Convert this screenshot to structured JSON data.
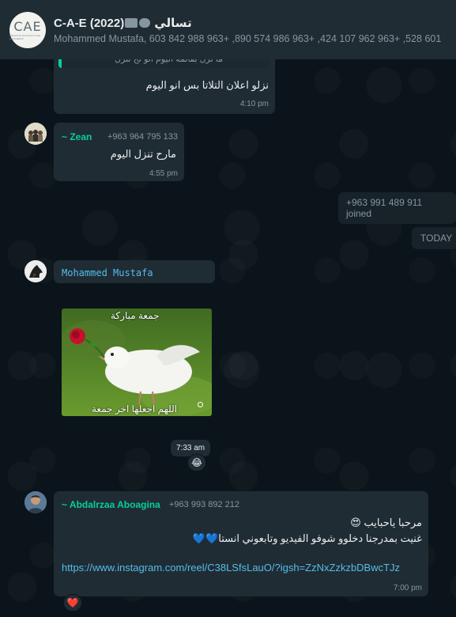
{
  "header": {
    "avatar_text": "CAE",
    "avatar_subtext": "CREATIVE ARCHITECTURE ENGINEERS",
    "title_prefix": "C-A-E (2022)",
    "title_suffix": "تسالي",
    "members": "Mohammed Mustafa, 603 842 988 963+ ,890 574 986 963+ ,424 107 962 963+ ,528 601"
  },
  "messages": {
    "m1": {
      "quote": "ما نزل بقائمة اليوم انو لح تنزل",
      "text": "نزلو اعلان التلاتا بس انو اليوم",
      "time": "4:10 pm"
    },
    "m2": {
      "sender": "~ Zean",
      "phone": "+963 964 795 133",
      "text": "مارح تنزل اليوم",
      "time": "4:55 pm"
    },
    "system_joined": "+963 991 489 911 joined",
    "date_divider": "TODAY",
    "m3": {
      "sender": "Mohammed Mustafa"
    },
    "m4": {
      "image_caption_top": "جمعة مباركة",
      "image_caption_bottom": "اللهم اجعلها اخر جمعة",
      "time": "7:33 am",
      "reaction": "😂"
    },
    "m5": {
      "sender": "~ Abdalrzaa Aboagina",
      "phone": "+963 993 892 212",
      "line1": "مرحبا ياحبايب 😍",
      "line2": "غنيت بمدرجنا دخلوو شوفو الفيديو وتابعوني انستا💙💙",
      "link": "https://www.instagram.com/reel/C38LSfsLauO/?igsh=ZzNxZzkzbDBwcTJz",
      "time": "7:00 pm",
      "reaction": "❤️"
    }
  },
  "colors": {
    "background": "#0b141a",
    "bubble": "#202c33",
    "header": "#202c33",
    "link": "#53bdeb",
    "name_teal": "#06cf9c",
    "muted": "#8696a0"
  }
}
